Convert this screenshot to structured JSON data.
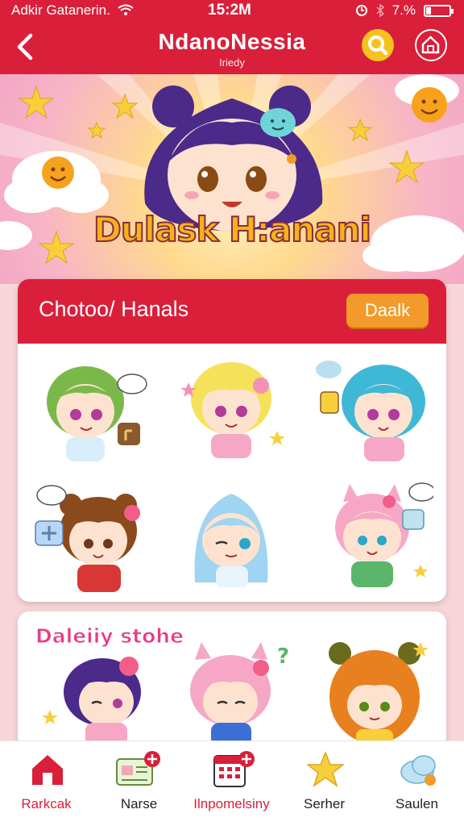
{
  "status": {
    "carrier": "Adkir Gatanerin.",
    "time": "15:2M",
    "battery": "7.%"
  },
  "header": {
    "title": "NdanoNessia",
    "subtitle": "Iriedy"
  },
  "hero": {
    "title": "Dulask H:anani"
  },
  "section1": {
    "title": "Chotoo/ Hanals",
    "button": "Daalk"
  },
  "section2": {
    "title": "Daleiiy stohe"
  },
  "tabs": [
    {
      "label": "Rarkcak",
      "icon": "home-icon"
    },
    {
      "label": "Narse",
      "icon": "card-add-icon"
    },
    {
      "label": "Ilnpomelsiny",
      "icon": "calendar-add-icon"
    },
    {
      "label": "Serher",
      "icon": "star-icon"
    },
    {
      "label": "Saulen",
      "icon": "cloud-icon"
    }
  ],
  "colors": {
    "brand": "#d91f3a",
    "accent": "#f39a2a",
    "search": "#f6c31c"
  }
}
